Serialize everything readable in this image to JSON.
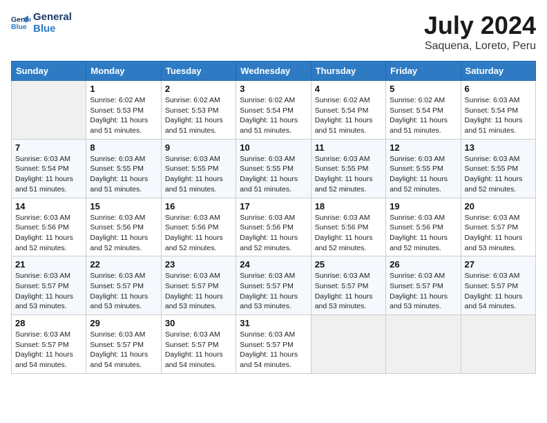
{
  "header": {
    "logo_line1": "General",
    "logo_line2": "Blue",
    "title": "July 2024",
    "subtitle": "Saquena, Loreto, Peru"
  },
  "columns": [
    "Sunday",
    "Monday",
    "Tuesday",
    "Wednesday",
    "Thursday",
    "Friday",
    "Saturday"
  ],
  "weeks": [
    [
      {
        "num": "",
        "info": ""
      },
      {
        "num": "1",
        "info": "Sunrise: 6:02 AM\nSunset: 5:53 PM\nDaylight: 11 hours\nand 51 minutes."
      },
      {
        "num": "2",
        "info": "Sunrise: 6:02 AM\nSunset: 5:53 PM\nDaylight: 11 hours\nand 51 minutes."
      },
      {
        "num": "3",
        "info": "Sunrise: 6:02 AM\nSunset: 5:54 PM\nDaylight: 11 hours\nand 51 minutes."
      },
      {
        "num": "4",
        "info": "Sunrise: 6:02 AM\nSunset: 5:54 PM\nDaylight: 11 hours\nand 51 minutes."
      },
      {
        "num": "5",
        "info": "Sunrise: 6:02 AM\nSunset: 5:54 PM\nDaylight: 11 hours\nand 51 minutes."
      },
      {
        "num": "6",
        "info": "Sunrise: 6:03 AM\nSunset: 5:54 PM\nDaylight: 11 hours\nand 51 minutes."
      }
    ],
    [
      {
        "num": "7",
        "info": "Sunrise: 6:03 AM\nSunset: 5:54 PM\nDaylight: 11 hours\nand 51 minutes."
      },
      {
        "num": "8",
        "info": "Sunrise: 6:03 AM\nSunset: 5:55 PM\nDaylight: 11 hours\nand 51 minutes."
      },
      {
        "num": "9",
        "info": "Sunrise: 6:03 AM\nSunset: 5:55 PM\nDaylight: 11 hours\nand 51 minutes."
      },
      {
        "num": "10",
        "info": "Sunrise: 6:03 AM\nSunset: 5:55 PM\nDaylight: 11 hours\nand 51 minutes."
      },
      {
        "num": "11",
        "info": "Sunrise: 6:03 AM\nSunset: 5:55 PM\nDaylight: 11 hours\nand 52 minutes."
      },
      {
        "num": "12",
        "info": "Sunrise: 6:03 AM\nSunset: 5:55 PM\nDaylight: 11 hours\nand 52 minutes."
      },
      {
        "num": "13",
        "info": "Sunrise: 6:03 AM\nSunset: 5:55 PM\nDaylight: 11 hours\nand 52 minutes."
      }
    ],
    [
      {
        "num": "14",
        "info": "Sunrise: 6:03 AM\nSunset: 5:56 PM\nDaylight: 11 hours\nand 52 minutes."
      },
      {
        "num": "15",
        "info": "Sunrise: 6:03 AM\nSunset: 5:56 PM\nDaylight: 11 hours\nand 52 minutes."
      },
      {
        "num": "16",
        "info": "Sunrise: 6:03 AM\nSunset: 5:56 PM\nDaylight: 11 hours\nand 52 minutes."
      },
      {
        "num": "17",
        "info": "Sunrise: 6:03 AM\nSunset: 5:56 PM\nDaylight: 11 hours\nand 52 minutes."
      },
      {
        "num": "18",
        "info": "Sunrise: 6:03 AM\nSunset: 5:56 PM\nDaylight: 11 hours\nand 52 minutes."
      },
      {
        "num": "19",
        "info": "Sunrise: 6:03 AM\nSunset: 5:56 PM\nDaylight: 11 hours\nand 52 minutes."
      },
      {
        "num": "20",
        "info": "Sunrise: 6:03 AM\nSunset: 5:57 PM\nDaylight: 11 hours\nand 53 minutes."
      }
    ],
    [
      {
        "num": "21",
        "info": "Sunrise: 6:03 AM\nSunset: 5:57 PM\nDaylight: 11 hours\nand 53 minutes."
      },
      {
        "num": "22",
        "info": "Sunrise: 6:03 AM\nSunset: 5:57 PM\nDaylight: 11 hours\nand 53 minutes."
      },
      {
        "num": "23",
        "info": "Sunrise: 6:03 AM\nSunset: 5:57 PM\nDaylight: 11 hours\nand 53 minutes."
      },
      {
        "num": "24",
        "info": "Sunrise: 6:03 AM\nSunset: 5:57 PM\nDaylight: 11 hours\nand 53 minutes."
      },
      {
        "num": "25",
        "info": "Sunrise: 6:03 AM\nSunset: 5:57 PM\nDaylight: 11 hours\nand 53 minutes."
      },
      {
        "num": "26",
        "info": "Sunrise: 6:03 AM\nSunset: 5:57 PM\nDaylight: 11 hours\nand 53 minutes."
      },
      {
        "num": "27",
        "info": "Sunrise: 6:03 AM\nSunset: 5:57 PM\nDaylight: 11 hours\nand 54 minutes."
      }
    ],
    [
      {
        "num": "28",
        "info": "Sunrise: 6:03 AM\nSunset: 5:57 PM\nDaylight: 11 hours\nand 54 minutes."
      },
      {
        "num": "29",
        "info": "Sunrise: 6:03 AM\nSunset: 5:57 PM\nDaylight: 11 hours\nand 54 minutes."
      },
      {
        "num": "30",
        "info": "Sunrise: 6:03 AM\nSunset: 5:57 PM\nDaylight: 11 hours\nand 54 minutes."
      },
      {
        "num": "31",
        "info": "Sunrise: 6:03 AM\nSunset: 5:57 PM\nDaylight: 11 hours\nand 54 minutes."
      },
      {
        "num": "",
        "info": ""
      },
      {
        "num": "",
        "info": ""
      },
      {
        "num": "",
        "info": ""
      }
    ]
  ]
}
